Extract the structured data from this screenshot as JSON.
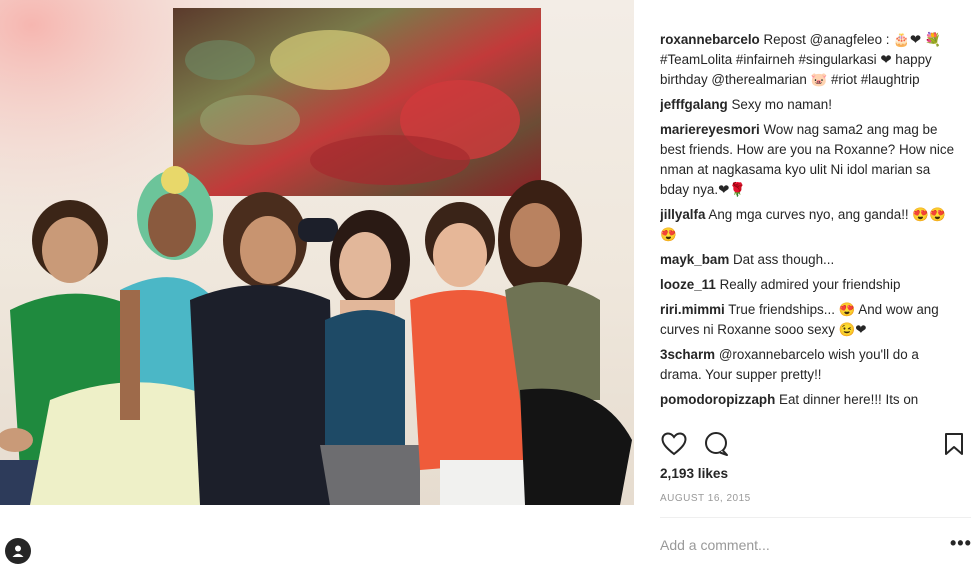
{
  "post": {
    "caption": {
      "username": "roxannebarcelo",
      "text": "Repost @anagfeleo : 🎂❤ 💐 #TeamLolita #infairneh #singularkasi ❤ happy birthday @therealmarian 🐷 #riot #laughtrip"
    },
    "comments": [
      {
        "username": "jefffgalang",
        "text": "Sexy mo naman!"
      },
      {
        "username": "mariereyesmori",
        "text": "Wow nag sama2 ang mag be best friends. How are you na Roxanne? How nice nman at nagkasama kyo ulit Ni idol marian sa bday nya.❤🌹"
      },
      {
        "username": "jillyalfa",
        "text": "Ang mga curves nyo, ang ganda!! 😍😍😍"
      },
      {
        "username": "mayk_bam",
        "text": "Dat ass though..."
      },
      {
        "username": "looze_11",
        "text": "Really admired your friendship"
      },
      {
        "username": "riri.mimmi",
        "text": "True friendships... 😍 And wow ang curves ni Roxanne sooo sexy 😉❤"
      },
      {
        "username": "3scharm",
        "text": "@roxannebarcelo wish you'll do a drama. Your supper pretty!!"
      },
      {
        "username": "pomodoropizzaph",
        "text": "Eat dinner here!!! Its on"
      }
    ],
    "likes": "2,193 likes",
    "date": "AUGUST 16, 2015",
    "add_comment_placeholder": "Add a comment...",
    "more_label": "•••"
  },
  "icons": {
    "like": "heart-icon",
    "comment": "speech-bubble-icon",
    "save": "bookmark-icon",
    "tag": "person-tag-icon"
  },
  "colors": {
    "text": "#262626",
    "muted": "#999999",
    "divider": "#efefef"
  }
}
